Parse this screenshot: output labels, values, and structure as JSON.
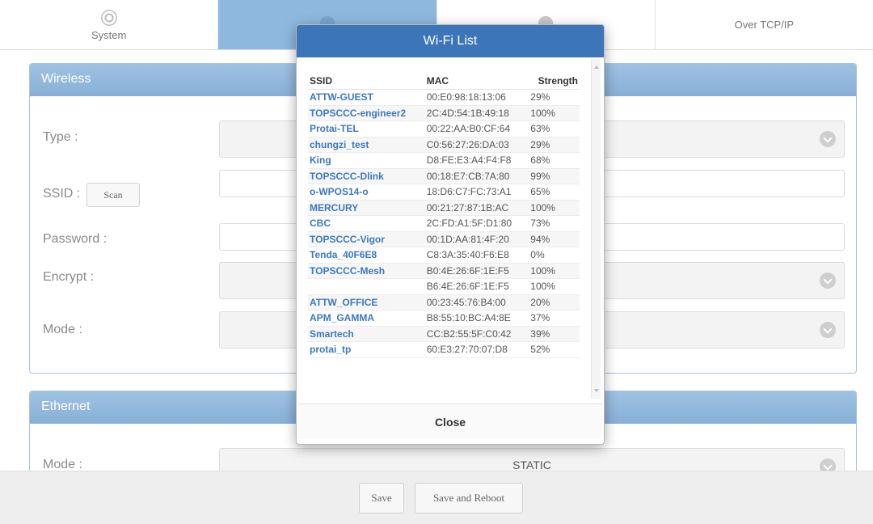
{
  "tabs": [
    {
      "label": "System",
      "icon": "gear-icon",
      "active": false
    },
    {
      "label": "",
      "icon": "network-icon",
      "active": true
    },
    {
      "label": "",
      "icon": "device-icon",
      "active": false
    },
    {
      "label": "Over TCP/IP",
      "icon": "",
      "active": false
    }
  ],
  "wireless": {
    "title": "Wireless",
    "type_label": "Type :",
    "ssid_label": "SSID :",
    "scan_label": "Scan",
    "password_label": "Password :",
    "encrypt_label": "Encrypt :",
    "mode_label": "Mode :"
  },
  "ethernet": {
    "title": "Ethernet",
    "mode_label": "Mode :",
    "mode_value": "STATIC"
  },
  "footer": {
    "save_label": "Save",
    "save_reboot_label": "Save and Reboot"
  },
  "modal": {
    "title": "Wi-Fi List",
    "columns": [
      "SSID",
      "MAC",
      "Strength"
    ],
    "rows": [
      {
        "ssid": "ATTW-GUEST",
        "mac": "00:E0:98:18:13:06",
        "strength": "29%"
      },
      {
        "ssid": "TOPSCCC-engineer2",
        "mac": "2C:4D:54:1B:49:18",
        "strength": "100%"
      },
      {
        "ssid": "Protai-TEL",
        "mac": "00:22:AA:B0:CF:64",
        "strength": "63%"
      },
      {
        "ssid": "chungzi_test",
        "mac": "C0:56:27:26:DA:03",
        "strength": "29%"
      },
      {
        "ssid": "King",
        "mac": "D8:FE:E3:A4:F4:F8",
        "strength": "68%"
      },
      {
        "ssid": "TOPSCCC-Dlink",
        "mac": "00:18:E7:CB:7A:80",
        "strength": "99%"
      },
      {
        "ssid": "o-WPOS14-o",
        "mac": "18:D6:C7:FC:73:A1",
        "strength": "65%"
      },
      {
        "ssid": "MERCURY",
        "mac": "00:21:27:87:1B:AC",
        "strength": "100%"
      },
      {
        "ssid": "CBC",
        "mac": "2C:FD:A1:5F:D1:80",
        "strength": "73%"
      },
      {
        "ssid": "TOPSCCC-Vigor",
        "mac": "00:1D:AA:81:4F:20",
        "strength": "94%"
      },
      {
        "ssid": "Tenda_40F6E8",
        "mac": "C8:3A:35:40:F6:E8",
        "strength": "0%"
      },
      {
        "ssid": "TOPSCCC-Mesh",
        "mac": "B0:4E:26:6F:1E:F5",
        "strength": "100%"
      },
      {
        "ssid": "",
        "mac": "B6:4E:26:6F:1E:F5",
        "strength": "100%"
      },
      {
        "ssid": "ATTW_OFFICE",
        "mac": "00:23:45:76:B4:00",
        "strength": "20%"
      },
      {
        "ssid": "APM_GAMMA",
        "mac": "B8:55:10:BC:A4:8E",
        "strength": "37%"
      },
      {
        "ssid": "Smartech",
        "mac": "CC:B2:55:5F:C0:42",
        "strength": "39%"
      },
      {
        "ssid": "protai_tp",
        "mac": "60:E3:27:70:07:D8",
        "strength": "52%"
      }
    ],
    "close_label": "Close"
  },
  "colors": {
    "tab_active": "#8fb8de",
    "panel_header": "#9fc2e3",
    "modal_header": "#3d76b8",
    "ssid_link": "#3b78c0"
  }
}
